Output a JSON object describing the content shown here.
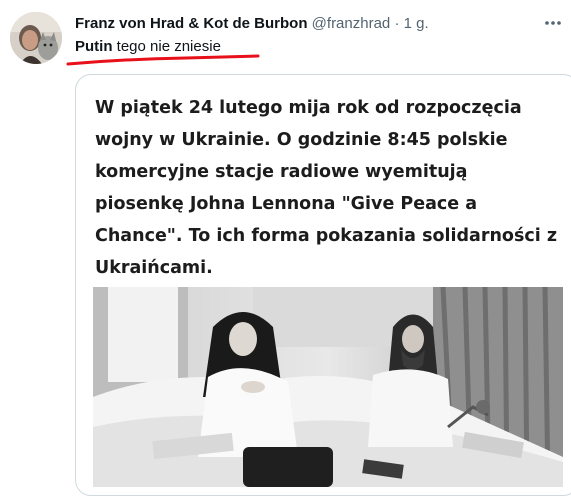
{
  "tweet": {
    "author_name": "Franz von Hrad & Kot de Burbon",
    "author_handle": "@franzhrad",
    "separator": "·",
    "time": "1 g.",
    "text_bold": "Putin",
    "text_rest": "tego nie zniesie",
    "icons": {
      "avatar": "avatar-photo",
      "more": "more-options-icon"
    },
    "annotation_color": "#e8101a"
  },
  "quoted": {
    "text": "W piątek 24 lutego mija rok od rozpoczęcia wojny w Ukrainie. O godzinie 8:45 polskie komercyjne stacje radiowe wyemitują piosenkę Johna Lennona \"Give Peace a Chance\". To ich forma pokazania solidarności z Ukraińcami."
  }
}
